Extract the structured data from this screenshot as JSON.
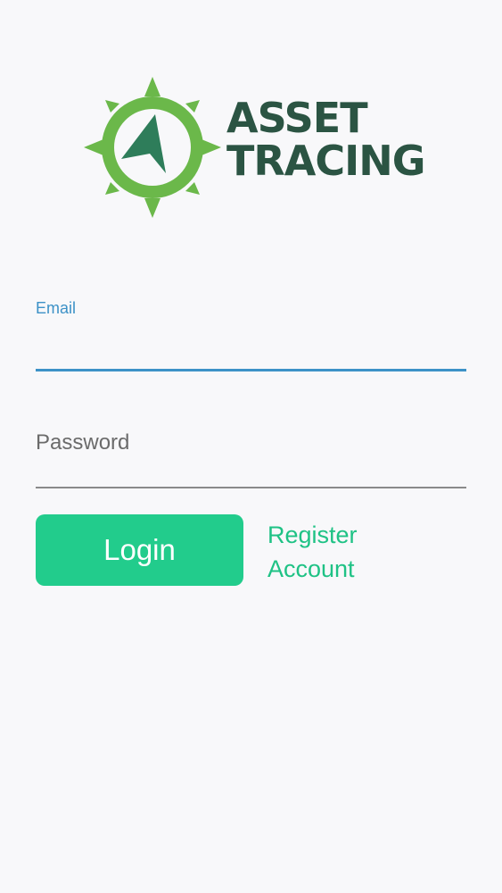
{
  "brand": {
    "name_line1": "ASSET",
    "name_line2": "TRACING",
    "logo_icon": "compass-icon",
    "colors": {
      "ring": "#6bb84a",
      "needle": "#2e7d5a",
      "text": "#2b5443"
    }
  },
  "form": {
    "email": {
      "label": "Email",
      "value": ""
    },
    "password": {
      "placeholder": "Password",
      "value": ""
    },
    "login_label": "Login",
    "register_label": "Register Account"
  },
  "colors": {
    "background": "#f8f8fa",
    "accent_green": "#22cc8c",
    "focus_blue": "#3d92c7"
  }
}
